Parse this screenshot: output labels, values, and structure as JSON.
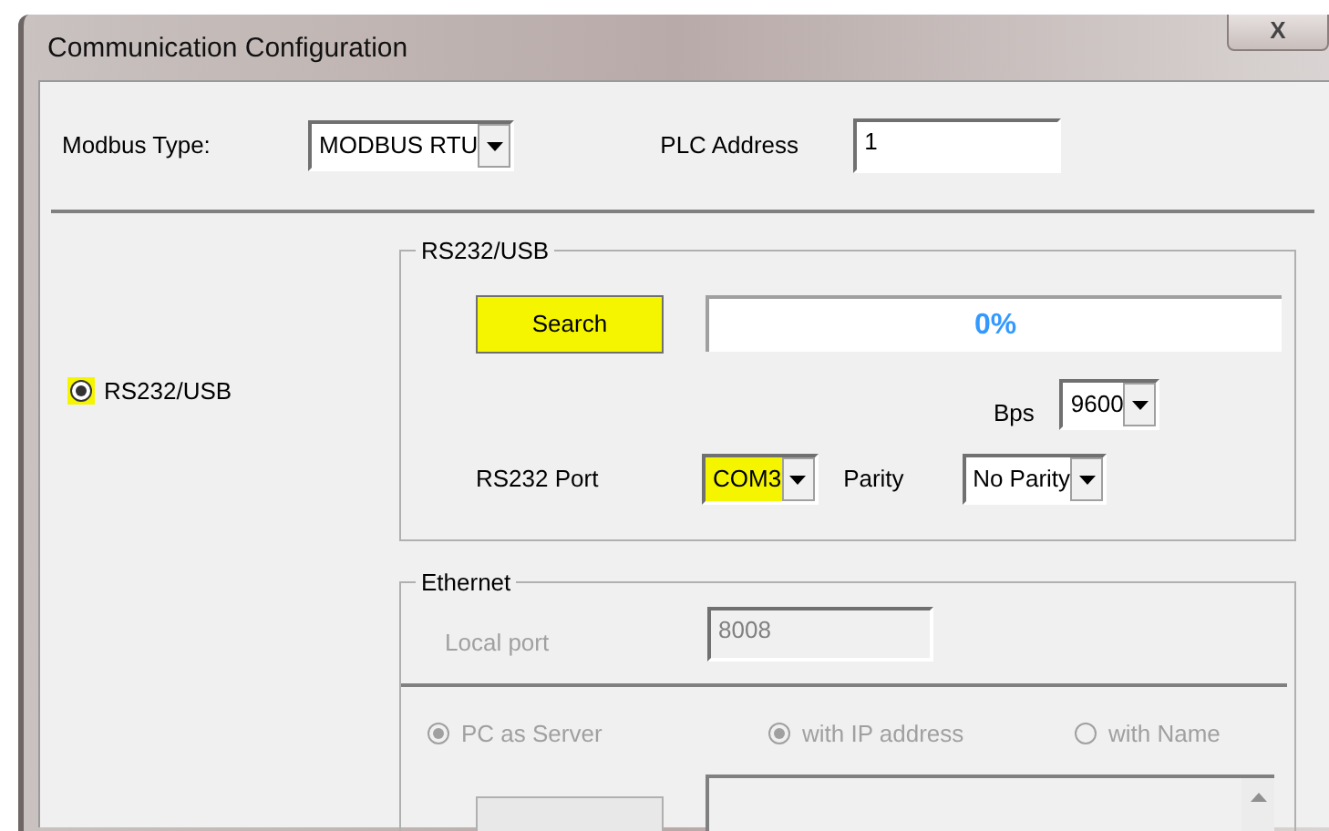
{
  "window": {
    "title": "Communication Configuration",
    "close": "X"
  },
  "modbus_type": {
    "label": "Modbus Type:",
    "value": "MODBUS RTU"
  },
  "plc_address": {
    "label": "PLC Address",
    "value": "1"
  },
  "mode_radio": {
    "label": "RS232/USB",
    "selected": true,
    "highlighted": true
  },
  "rs232": {
    "legend": "RS232/USB",
    "search_button": {
      "label": "Search",
      "highlighted": true
    },
    "progress": {
      "text": "0%",
      "level": 0
    },
    "bps": {
      "label": "Bps",
      "value": "9600"
    },
    "port": {
      "label": "RS232 Port",
      "value": "COM3",
      "highlighted": true
    },
    "parity": {
      "label": "Parity",
      "value": "No Parity"
    }
  },
  "ethernet": {
    "legend": "Ethernet",
    "disabled": true,
    "local_port": {
      "label": "Local port",
      "value": "8008"
    },
    "radios": [
      {
        "label": "PC as Server",
        "selected": true
      },
      {
        "label": "with IP address",
        "selected": true
      },
      {
        "label": "with Name",
        "selected": false
      }
    ]
  }
}
